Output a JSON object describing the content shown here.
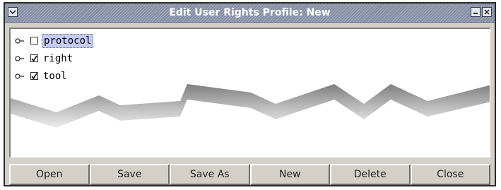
{
  "window": {
    "title": "Edit User Rights Profile: New",
    "controls": [
      "menu-icon",
      "minimize-icon",
      "close-icon"
    ]
  },
  "tree": {
    "items": [
      {
        "label": "protocol",
        "checked": false,
        "selected": true
      },
      {
        "label": "right",
        "checked": true,
        "selected": false
      },
      {
        "label": "tool",
        "checked": true,
        "selected": false
      }
    ]
  },
  "buttons": {
    "open": "Open",
    "save": "Save",
    "save_as": "Save As",
    "new": "New",
    "delete": "Delete",
    "close": "Close"
  }
}
